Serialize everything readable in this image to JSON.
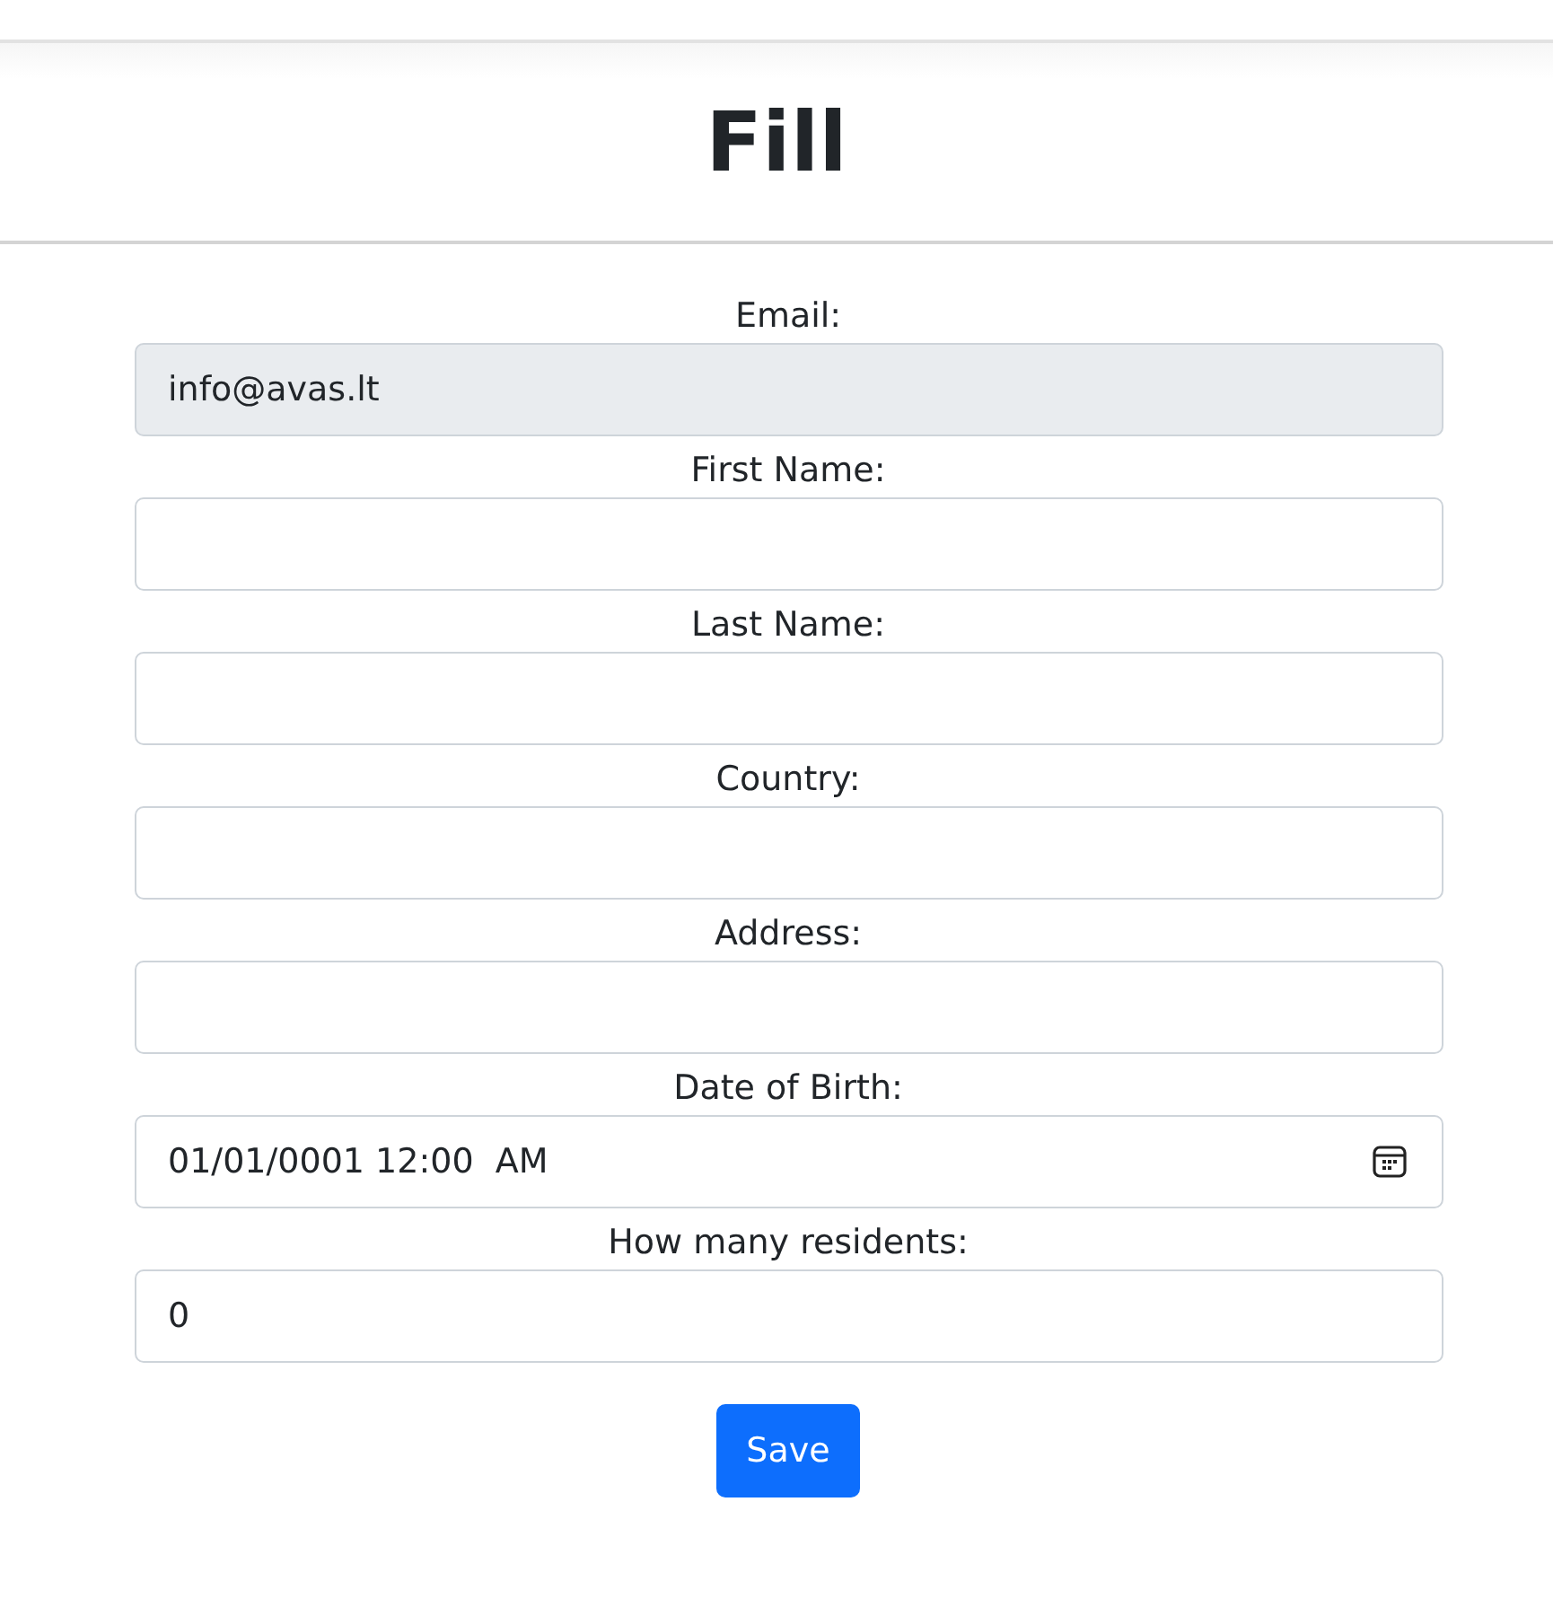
{
  "header": {
    "title": "Fill"
  },
  "fields": [
    {
      "label": "Email:",
      "kind": "text",
      "value": "info@avas.lt",
      "disabled": true
    },
    {
      "label": "First Name:",
      "kind": "text",
      "disabled": false
    },
    {
      "label": "Last Name:",
      "kind": "text",
      "disabled": false
    },
    {
      "label": "Country:",
      "kind": "text",
      "disabled": false
    },
    {
      "label": "Address:",
      "kind": "text",
      "disabled": false
    },
    {
      "label": "Date of Birth:",
      "kind": "date",
      "value": "01/01/0001 12:00  AM",
      "disabled": false
    },
    {
      "label": "How many residents:",
      "kind": "number",
      "value": "0",
      "disabled": false
    }
  ],
  "buttons": [
    {
      "label": "Save"
    }
  ]
}
